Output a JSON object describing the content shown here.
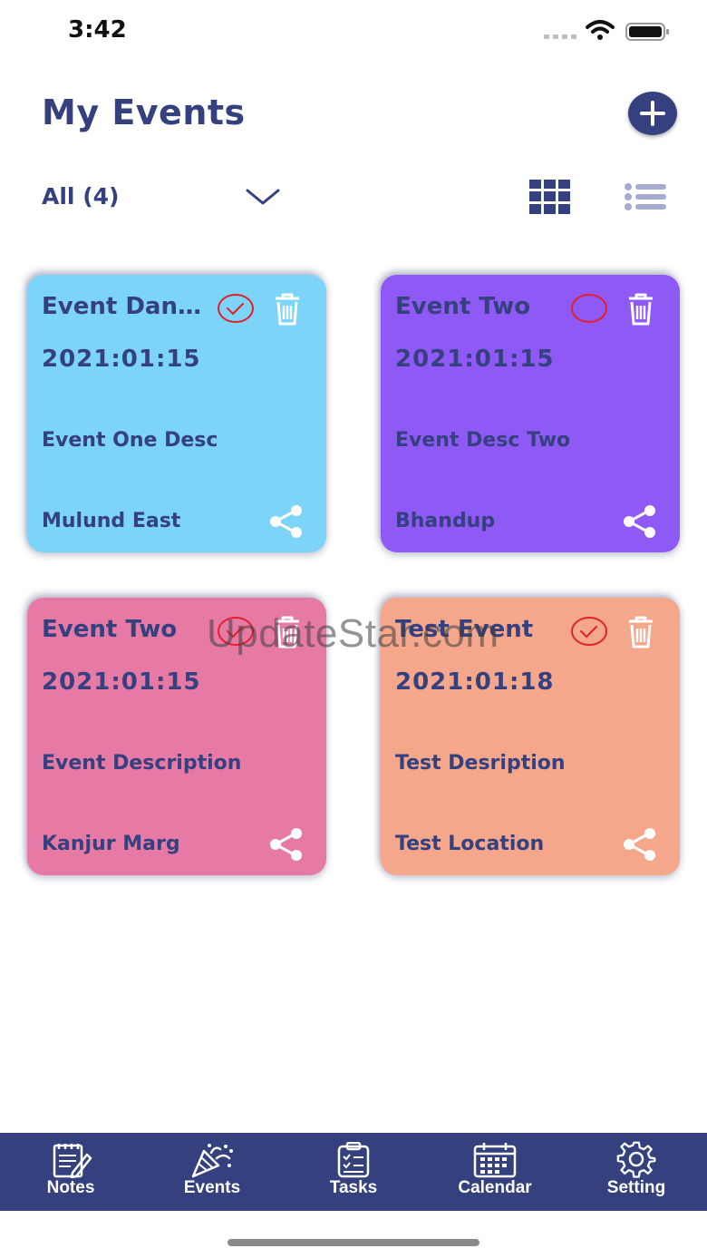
{
  "status_bar": {
    "time": "3:42"
  },
  "header": {
    "title": "My Events"
  },
  "filter": {
    "label": "All (4)"
  },
  "cards": [
    {
      "title": "Event Dan...",
      "date": "2021:01:15",
      "description": "Event One Desc",
      "location": "Mulund East",
      "color": "#7dd4f9",
      "checked": true
    },
    {
      "title": "Event Two",
      "date": "2021:01:15",
      "description": "Event Desc Two",
      "location": "Bhandup",
      "color": "#8e59f5",
      "checked": false
    },
    {
      "title": "Event Two",
      "date": "2021:01:15",
      "description": "Event Description",
      "location": "Kanjur Marg",
      "color": "#e77aa5",
      "checked": true
    },
    {
      "title": "Test Event",
      "date": "2021:01:18",
      "description": "Test Desription",
      "location": "Test Location",
      "color": "#f4a78b",
      "checked": true
    }
  ],
  "watermark": "UpdateStar.com",
  "tab_bar": {
    "items": [
      {
        "label": "Notes",
        "icon": "notes-icon"
      },
      {
        "label": "Events",
        "icon": "party-popper-icon"
      },
      {
        "label": "Tasks",
        "icon": "clipboard-icon"
      },
      {
        "label": "Calendar",
        "icon": "calendar-icon"
      },
      {
        "label": "Setting",
        "icon": "gear-icon"
      }
    ]
  },
  "colors": {
    "primary": "#35407f",
    "check_red": "#e0202a"
  }
}
